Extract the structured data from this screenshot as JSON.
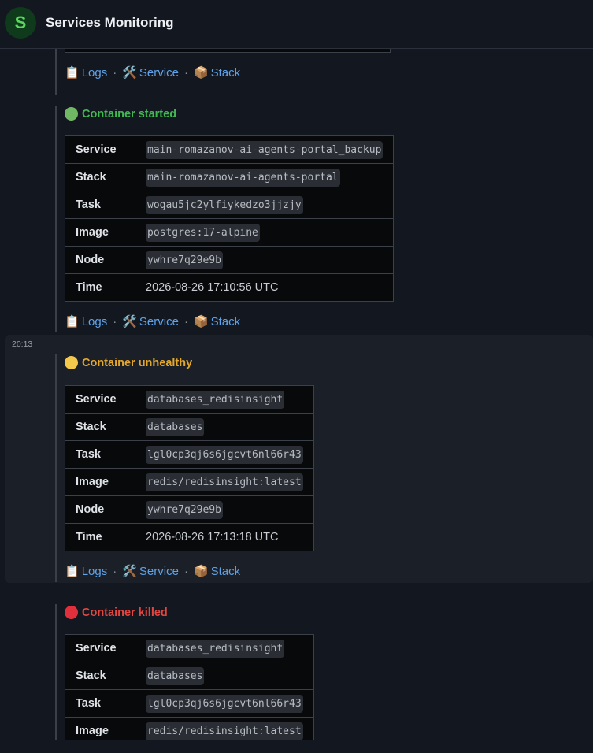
{
  "header": {
    "avatar_letter": "S",
    "title": "Services Monitoring"
  },
  "links": {
    "logs": "Logs",
    "service": "Service",
    "stack": "Stack",
    "separator": "·",
    "logs_icon": "📋",
    "service_icon": "🛠️",
    "stack_icon": "📦"
  },
  "labels": {
    "service": "Service",
    "stack": "Stack",
    "task": "Task",
    "image": "Image",
    "node": "Node",
    "time": "Time"
  },
  "messages": [
    {
      "event": "Container started",
      "status_color": "#71b864",
      "text_color": "#3fb950",
      "service": "main-romazanov-ai-agents-portal_backup",
      "stack": "main-romazanov-ai-agents-portal",
      "task": "wogau5jc2ylfiykedzo3jjzjy",
      "image": "postgres:17-alpine",
      "node": "ywhre7q29e9b",
      "time": "2026-08-26 17:10:56 UTC"
    },
    {
      "timestamp": "20:13",
      "event": "Container unhealthy",
      "status_color": "#f4c84a",
      "text_color": "#e3a72e",
      "service": "databases_redisinsight",
      "stack": "databases",
      "task": "lgl0cp3qj6s6jgcvt6nl66r43",
      "image": "redis/redisinsight:latest",
      "node": "ywhre7q29e9b",
      "time": "2026-08-26 17:13:18 UTC"
    },
    {
      "event": "Container killed",
      "status_color": "#e0303b",
      "text_color": "#e5453f",
      "service": "databases_redisinsight",
      "stack": "databases",
      "task": "lgl0cp3qj6s6jgcvt6nl66r43",
      "image": "redis/redisinsight:latest"
    }
  ]
}
